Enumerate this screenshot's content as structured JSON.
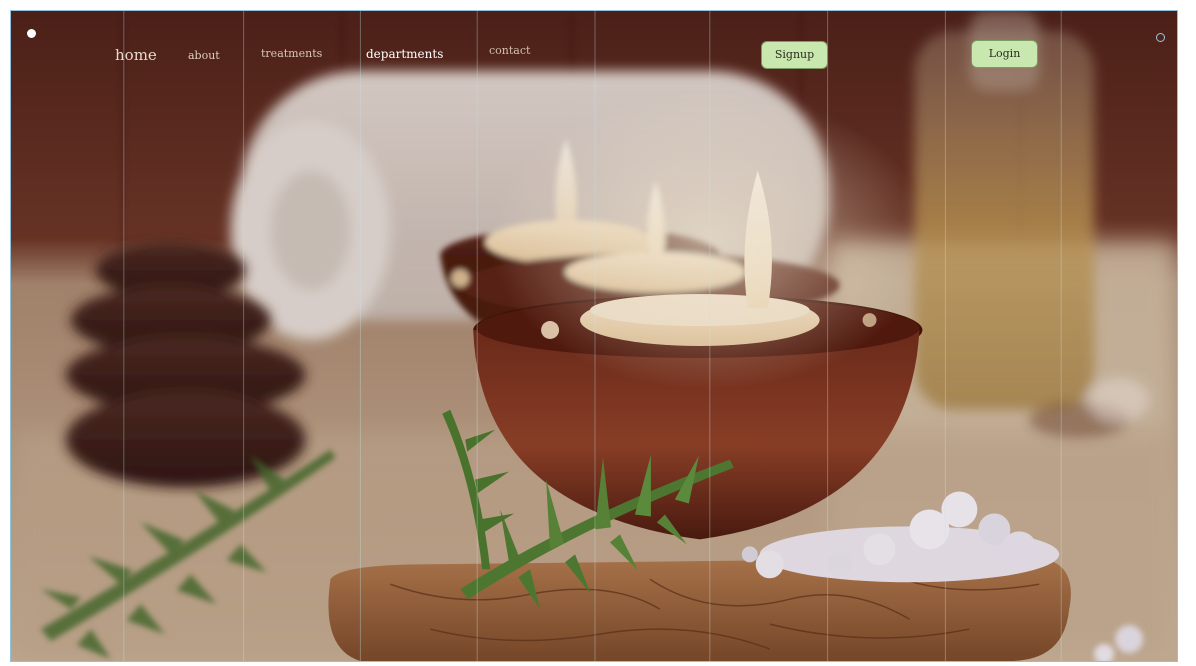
{
  "nav": {
    "home": "home",
    "about": "about",
    "treatments": "treatments",
    "departments": "departments",
    "contact": "contact"
  },
  "auth": {
    "signup": "Signup",
    "login": "Login"
  },
  "colors": {
    "button_bg": "#c9e8b0",
    "button_border": "#7b9a64",
    "frame_border": "#8fc3dc",
    "wall": "#5a2d22",
    "table": "#c9b49a"
  },
  "hero": {
    "image": "spa-candles-photo"
  }
}
